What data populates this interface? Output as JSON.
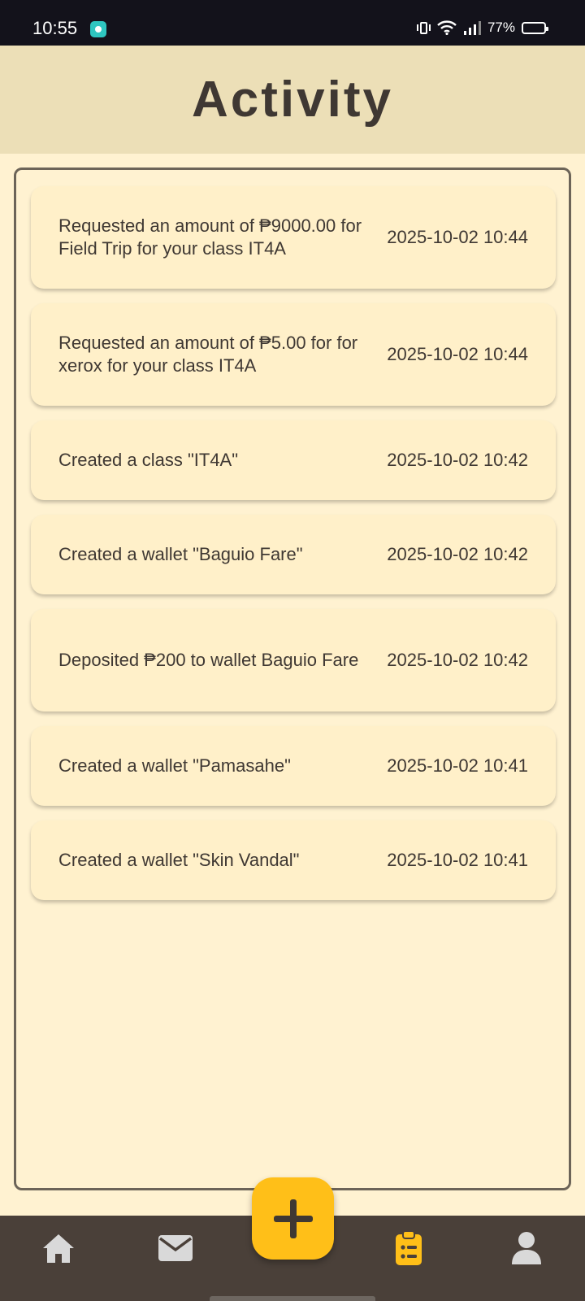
{
  "status_bar": {
    "time": "10:55",
    "battery_text": "77%",
    "battery_level": 0.77,
    "icons": [
      "app-notification-icon",
      "vibrate-icon",
      "wifi-icon",
      "signal-icon",
      "battery-icon"
    ]
  },
  "header": {
    "title": "Activity"
  },
  "activities": [
    {
      "description": "Requested an amount of ₱9000.00 for Field Trip for your class IT4A",
      "time": "2025-10-02 10:44"
    },
    {
      "description": "Requested an amount of ₱5.00 for for xerox for your class IT4A",
      "time": "2025-10-02 10:44"
    },
    {
      "description": "Created a class \"IT4A\"",
      "time": "2025-10-02 10:42"
    },
    {
      "description": "Created a wallet \"Baguio Fare\"",
      "time": "2025-10-02 10:42"
    },
    {
      "description": "Deposited ₱200 to wallet Baguio Fare",
      "time": "2025-10-02 10:42"
    },
    {
      "description": "Created a wallet \"Pamasahe\"",
      "time": "2025-10-02 10:41"
    },
    {
      "description": "Created a wallet \"Skin Vandal\"",
      "time": "2025-10-02 10:41"
    }
  ],
  "fab": {
    "icon": "plus-icon"
  },
  "bottom_nav": {
    "items": [
      {
        "icon": "home-icon",
        "active": false
      },
      {
        "icon": "mail-icon",
        "active": false
      },
      {
        "icon": "clipboard-list-icon",
        "active": true
      },
      {
        "icon": "profile-icon",
        "active": false
      }
    ]
  },
  "colors": {
    "status_bar_bg": "#13121b",
    "header_bg": "#ecdfb7",
    "page_bg": "#fff2d1",
    "card_bg": "#fff0c9",
    "text": "#3f3833",
    "accent": "#ffbf18",
    "nav_bg": "#4a4039",
    "nav_icon_inactive": "#d9d9d9"
  }
}
